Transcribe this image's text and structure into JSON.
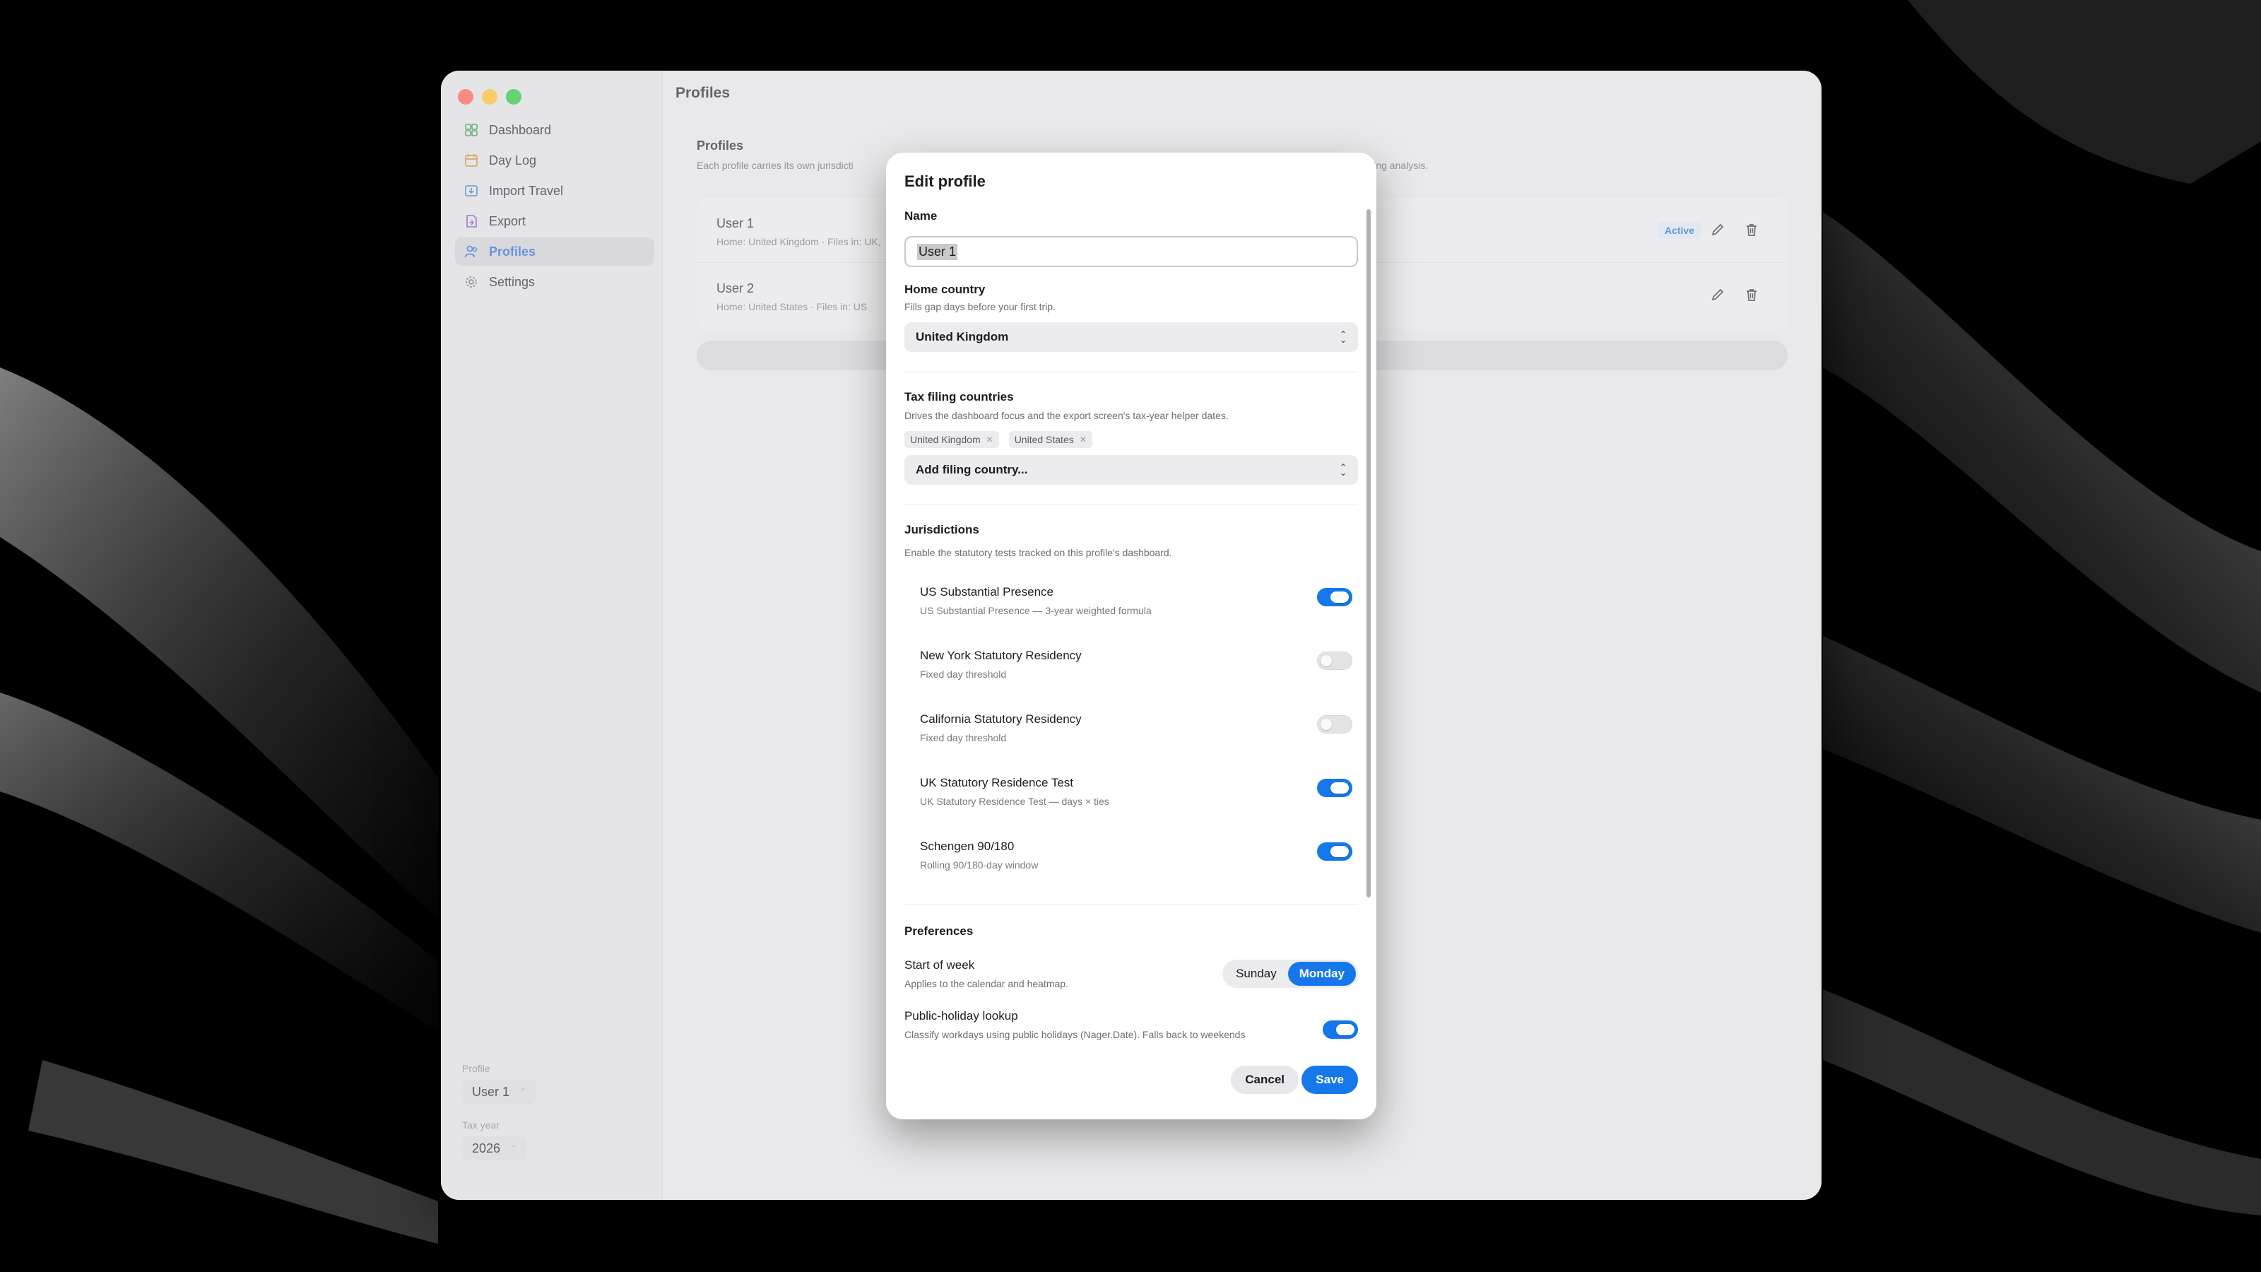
{
  "window": {
    "title": "Profiles"
  },
  "sidebar": {
    "items": [
      {
        "label": "Dashboard",
        "icon": "dashboard-icon",
        "color": "#4a9a5a"
      },
      {
        "label": "Day Log",
        "icon": "calendar-icon",
        "color": "#d08a3a"
      },
      {
        "label": "Import Travel",
        "icon": "import-icon",
        "color": "#4a86c8"
      },
      {
        "label": "Export",
        "icon": "export-icon",
        "color": "#8a5ac8"
      },
      {
        "label": "Profiles",
        "icon": "person-icon",
        "color": "#2c6fd1"
      },
      {
        "label": "Settings",
        "icon": "gear-icon",
        "color": "#7a7a7f"
      }
    ],
    "active": "Profiles",
    "profile_label": "Profile",
    "profile_value": "User 1",
    "tax_year_label": "Tax year",
    "tax_year_value": "2026"
  },
  "main": {
    "section_title": "Profiles",
    "section_desc": "Each profile carries its own jurisdicti",
    "section_desc_right": "iling analysis.",
    "profiles": [
      {
        "name": "User 1",
        "meta": "Home: United Kingdom · Files in: UK,",
        "active_label": "Active"
      },
      {
        "name": "User 2",
        "meta": "Home: United States · Files in: US"
      }
    ]
  },
  "modal": {
    "title": "Edit profile",
    "name_label": "Name",
    "name_value": "User 1",
    "home_label": "Home country",
    "home_help": "Fills gap days before your first trip.",
    "home_value": "United Kingdom",
    "tax_label": "Tax filing countries",
    "tax_help": "Drives the dashboard focus and the export screen's tax-year helper dates.",
    "tax_chips": [
      "United Kingdom",
      "United States"
    ],
    "tax_add_placeholder": "Add filing country...",
    "jur_label": "Jurisdictions",
    "jur_help": "Enable the statutory tests tracked on this profile's dashboard.",
    "jurisdictions": [
      {
        "title": "US Substantial Presence",
        "sub": "US Substantial Presence — 3-year weighted formula",
        "on": true
      },
      {
        "title": "New York Statutory Residency",
        "sub": "Fixed day threshold",
        "on": false
      },
      {
        "title": "California Statutory Residency",
        "sub": "Fixed day threshold",
        "on": false
      },
      {
        "title": "UK Statutory Residence Test",
        "sub": "UK Statutory Residence Test — days × ties",
        "on": true
      },
      {
        "title": "Schengen 90/180",
        "sub": "Rolling 90/180-day window",
        "on": true
      }
    ],
    "pref_label": "Preferences",
    "week_label": "Start of week",
    "week_help": "Applies to the calendar and heatmap.",
    "week_options": [
      "Sunday",
      "Monday"
    ],
    "week_selected": "Monday",
    "holiday_label": "Public-holiday lookup",
    "holiday_help": "Classify workdays using public holidays (Nager.Date). Falls back to weekends",
    "holiday_on": true,
    "cancel_label": "Cancel",
    "save_label": "Save"
  }
}
